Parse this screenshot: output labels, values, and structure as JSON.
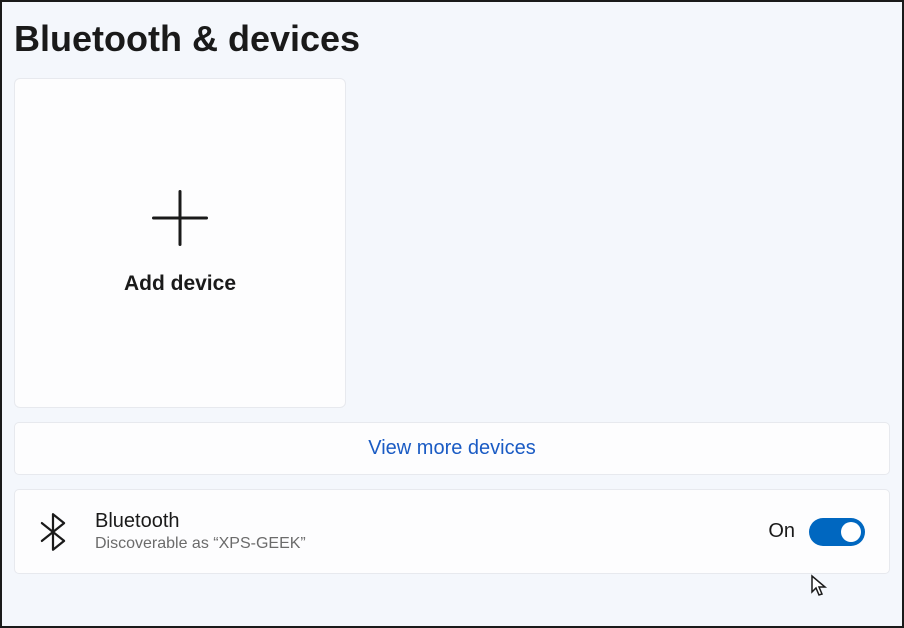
{
  "page": {
    "title": "Bluetooth & devices"
  },
  "addDevice": {
    "label": "Add device"
  },
  "viewMore": {
    "label": "View more devices"
  },
  "bluetooth": {
    "title": "Bluetooth",
    "subtitle": "Discoverable as “XPS-GEEK”",
    "toggleState": "On"
  },
  "colors": {
    "accent": "#0067c0",
    "cardBg": "#fdfdfe",
    "pageBg": "#f4f7fc",
    "link": "#1a5bc4"
  }
}
